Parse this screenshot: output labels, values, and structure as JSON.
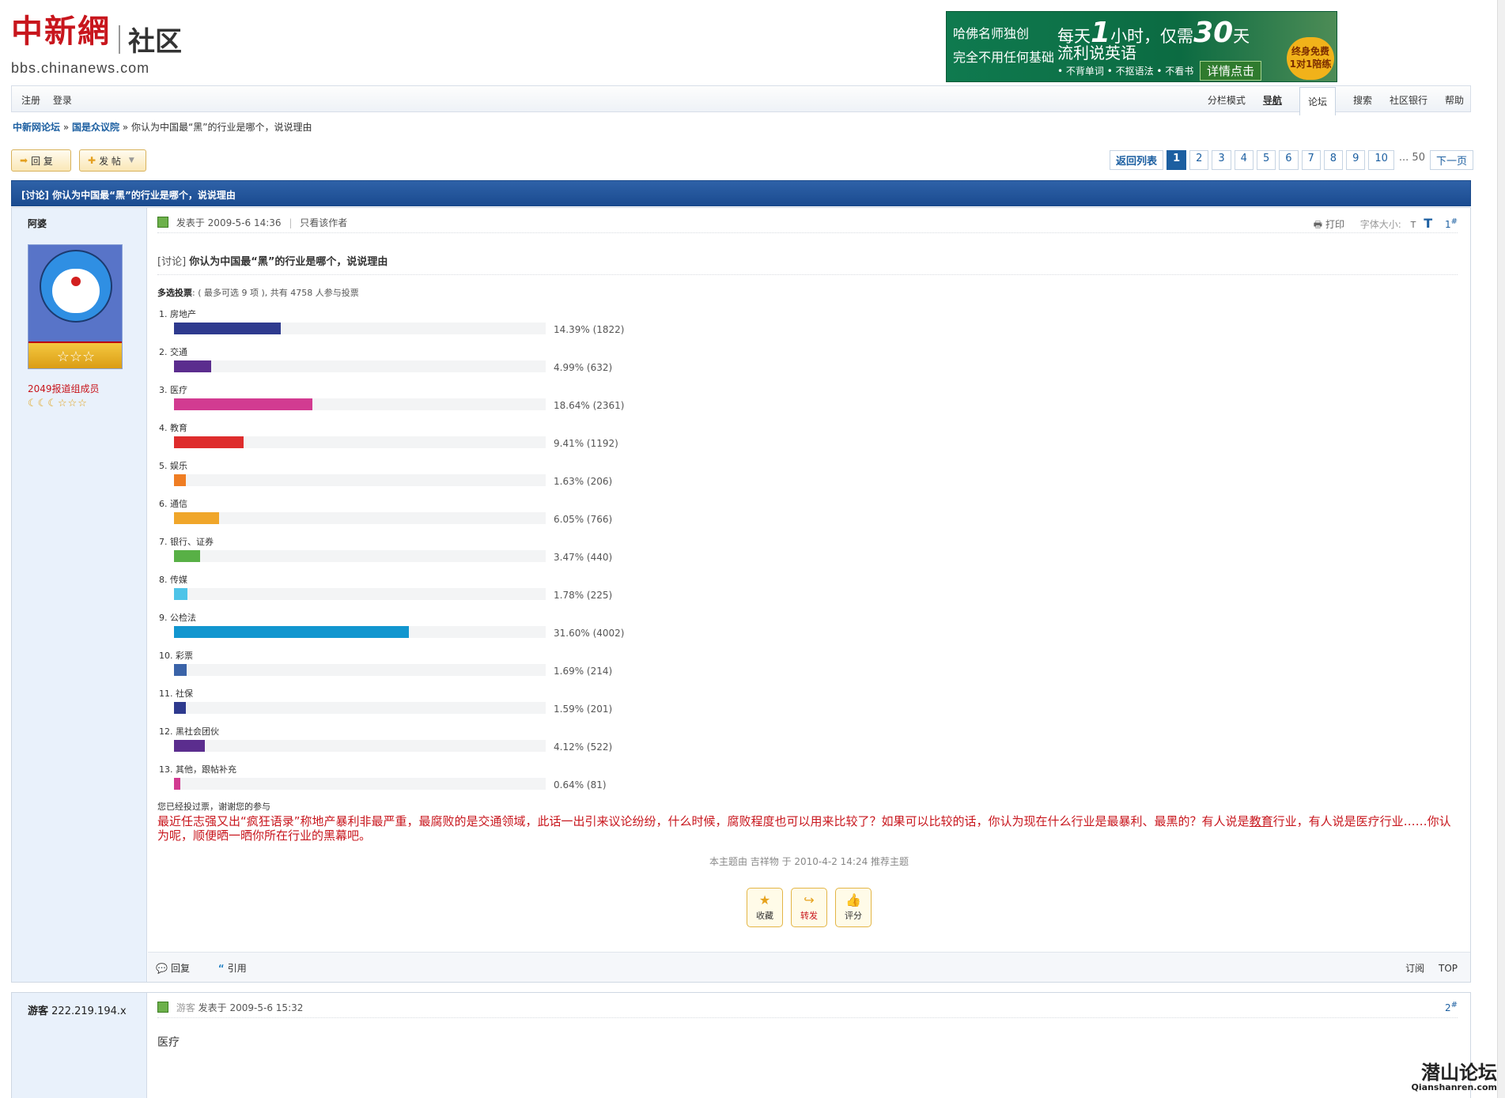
{
  "header": {
    "logo_brand": "中新網",
    "logo_sub": "社区",
    "logo_url": "bbs.chinanews.com"
  },
  "ad": {
    "line1": "哈佛名师独创",
    "line2": "完全不用任何基础",
    "line3_prefix": "每天",
    "line3_num1": "1",
    "line3_mid": "小时，仅需",
    "line3_num2": "30",
    "line3_suffix": "天",
    "line4": "流利说英语",
    "line5": "• 不背单词 • 不抠语法 • 不看书",
    "cta": "详情点击",
    "seal": "终身免费 1对1陪练"
  },
  "topbar": {
    "register": "注册",
    "login": "登录",
    "nav": [
      "分栏模式",
      "导航",
      "论坛",
      "搜索",
      "社区银行",
      "帮助"
    ]
  },
  "breadcrumb": {
    "forum": "中新网论坛",
    "board": "国是众议院",
    "sep": "»",
    "current": "你认为中国最“黑”的行业是哪个，说说理由"
  },
  "buttons": {
    "reply": "回 复",
    "post": "发 帖"
  },
  "pager": {
    "back": "返回列表",
    "pages": [
      "1",
      "2",
      "3",
      "4",
      "5",
      "6",
      "7",
      "8",
      "9",
      "10"
    ],
    "last": "... 50",
    "next": "下一页"
  },
  "thread": {
    "title": "[讨论] 你认为中国最“黑”的行业是哪个，说说理由"
  },
  "post1": {
    "author": "阿婆",
    "rank_badge": "☆☆☆",
    "group": "2049报道组成员",
    "stars": "☾☾☾☆☆☆",
    "posted_label": "发表于",
    "posted_time": "2009-5-6 14:36",
    "only_author": "只看该作者",
    "print": "打印",
    "font_size_label": "字体大小:",
    "font_small": "T",
    "font_large": "T",
    "floor": "1",
    "title_tag": "[讨论]",
    "title": "你认为中国最“黑”的行业是哪个，说说理由",
    "poll_type": "多选投票",
    "poll_info": ": ( 最多可选 9 项 ), 共有 4758 人参与投票",
    "voted_msg": "您已经投过票，谢谢您的参与",
    "text_part1": "最近任志强又出“疯狂语录”称地产暴利非最严重，最腐败的是交通领域，此话一出引来议论纷纷，什么时候，腐败程度也可以用来比较了？如果可以比较的话，你认为现在什么行业是最暴利、最黑的？有人说是",
    "text_underlined": "教育",
    "text_part2": "行业，有人说是医疗行业……你认为呢，顺便晒一晒你所在行业的黑幕吧。",
    "recommend": "本主题由 吉祥物 于 2010-4-2 14:24 推荐主题",
    "actions": [
      "收藏",
      "转发",
      "评分"
    ],
    "foot_reply": "回复",
    "foot_quote": "引用",
    "foot_subscribe": "订阅",
    "foot_top": "TOP"
  },
  "poll_options": [
    {
      "label": "1.  房地产",
      "percent": 14.39,
      "count": 1822,
      "pct_text": "14.39% (1822)",
      "color": "#2e3a8e"
    },
    {
      "label": "2.  交通",
      "percent": 4.99,
      "count": 632,
      "pct_text": "4.99% (632)",
      "color": "#5b2d8e"
    },
    {
      "label": "3.  医疗",
      "percent": 18.64,
      "count": 2361,
      "pct_text": "18.64% (2361)",
      "color": "#d23b91"
    },
    {
      "label": "4.  教育",
      "percent": 9.41,
      "count": 1192,
      "pct_text": "9.41% (1192)",
      "color": "#de2c2c"
    },
    {
      "label": "5.  娱乐",
      "percent": 1.63,
      "count": 206,
      "pct_text": "1.63% (206)",
      "color": "#ef7d23"
    },
    {
      "label": "6.  通信",
      "percent": 6.05,
      "count": 766,
      "pct_text": "6.05% (766)",
      "color": "#f0a62a"
    },
    {
      "label": "7.  银行、证券",
      "percent": 3.47,
      "count": 440,
      "pct_text": "3.47% (440)",
      "color": "#58b046"
    },
    {
      "label": "8.  传媒",
      "percent": 1.78,
      "count": 225,
      "pct_text": "1.78% (225)",
      "color": "#4ec4e8"
    },
    {
      "label": "9.  公检法",
      "percent": 31.6,
      "count": 4002,
      "pct_text": "31.60% (4002)",
      "color": "#1296cf"
    },
    {
      "label": "10.  彩票",
      "percent": 1.69,
      "count": 214,
      "pct_text": "1.69% (214)",
      "color": "#3a63a8"
    },
    {
      "label": "11.  社保",
      "percent": 1.59,
      "count": 201,
      "pct_text": "1.59% (201)",
      "color": "#2e3a8e"
    },
    {
      "label": "12.  黑社会团伙",
      "percent": 4.12,
      "count": 522,
      "pct_text": "4.12% (522)",
      "color": "#5b2d8e"
    },
    {
      "label": "13.  其他，跟帖补充",
      "percent": 0.64,
      "count": 81,
      "pct_text": "0.64% (81)",
      "color": "#d23b91"
    }
  ],
  "post2": {
    "author_label": "游客",
    "author_ip": "222.219.194.x",
    "guest": "游客",
    "posted_label": "发表于",
    "posted_time": "2009-5-6 15:32",
    "floor": "2",
    "text": "医疗"
  },
  "watermark": {
    "line1": "潜山论坛",
    "line2": "Qianshanren.com"
  },
  "colors": {
    "accent": "#1c5fa1",
    "brand_red": "#c8161d",
    "thread_header": "#1a4b90"
  }
}
